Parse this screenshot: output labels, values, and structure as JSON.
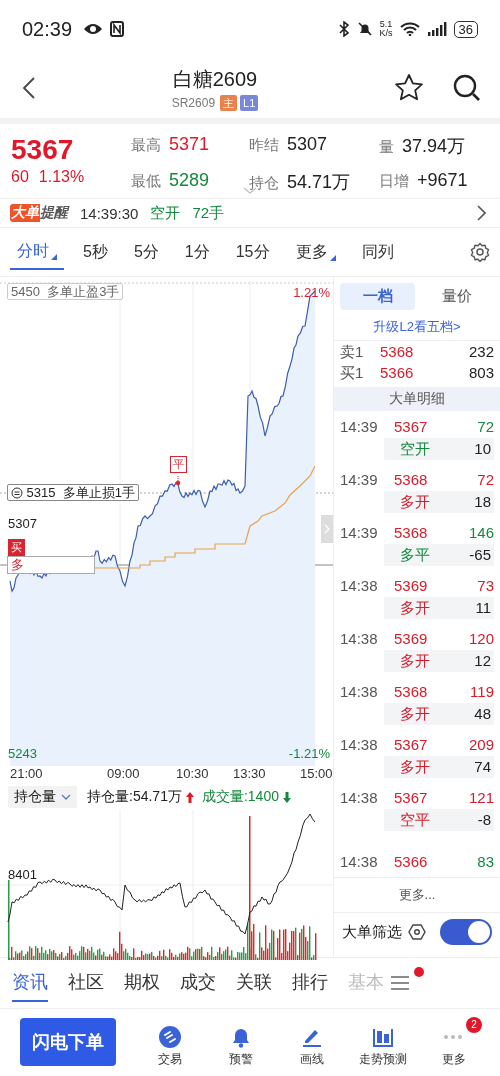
{
  "status_bar": {
    "time": "02:39",
    "net_speed_value": "5.1",
    "net_speed_unit": "K/s",
    "battery": "36"
  },
  "header": {
    "title": "白糖2609",
    "code": "SR2609",
    "badges": [
      {
        "label": "主",
        "color": "#e8814a"
      },
      {
        "label": "L1",
        "color": "#7a87d6"
      }
    ]
  },
  "quote": {
    "price": "5367",
    "change": "60",
    "change_pct": "1.13%",
    "stats": [
      {
        "label": "最高",
        "value": "5371",
        "color": "#e0192a"
      },
      {
        "label": "昨结",
        "value": "5307",
        "color": "#222222"
      },
      {
        "label": "量",
        "value": "37.94万",
        "color": "#222222"
      },
      {
        "label": "最低",
        "value": "5289",
        "color": "#14883c"
      },
      {
        "label": "持仓",
        "value": "54.71万",
        "color": "#222222"
      },
      {
        "label": "日增",
        "value": "+9671",
        "color": "#222222"
      }
    ]
  },
  "alert": {
    "badge_a": "大单",
    "badge_b": "提醒",
    "time": "14:39:30",
    "type": "空开",
    "lots": "72手"
  },
  "period_tabs": [
    {
      "label": "分时",
      "selected": true,
      "dropdown": true
    },
    {
      "label": "5秒",
      "selected": false,
      "dropdown": false
    },
    {
      "label": "5分",
      "selected": false,
      "dropdown": false
    },
    {
      "label": "1分",
      "selected": false,
      "dropdown": false
    },
    {
      "label": "15分",
      "selected": false,
      "dropdown": false
    },
    {
      "label": "更多",
      "selected": false,
      "dropdown": true
    },
    {
      "label": "同列",
      "selected": false,
      "dropdown": false
    }
  ],
  "price_chart": {
    "tp_price": "5450",
    "tp_text": "多单止盈3手",
    "high_pct": "1.21%",
    "sl_price": "5315",
    "sl_text": "多单止损1手",
    "prev_close": "5307",
    "buy_mark": "买",
    "position_tag": "多",
    "close_mark": "平",
    "low_price": "5243",
    "low_pct": "-1.21%",
    "x_labels": [
      "21:00",
      "09:00",
      "10:30",
      "13:30",
      "15:00"
    ]
  },
  "lower_chart": {
    "selector": "持仓量",
    "oi_label": "持仓量:54.71万",
    "oi_rising": true,
    "vol_label": "成交量:1400",
    "vol_rising": false,
    "y_label": "8401"
  },
  "side_panel": {
    "tabs": [
      {
        "label": "一档",
        "selected": true
      },
      {
        "label": "量价",
        "selected": false
      }
    ],
    "upgrade_link": "升级L2看五档>",
    "book": [
      {
        "label": "卖1",
        "price": "5368",
        "volume": "232"
      },
      {
        "label": "买1",
        "price": "5366",
        "volume": "803"
      }
    ],
    "trades_title": "大单明细",
    "trades": [
      {
        "time": "14:39",
        "price": "5367",
        "volume": "72",
        "color": "#14883c",
        "type": {
          "label": "空开",
          "color": "#14883c"
        },
        "change": "10"
      },
      {
        "time": "14:39",
        "price": "5368",
        "volume": "72",
        "color": "#d91b2a",
        "type": {
          "label": "多开",
          "color": "#d91b2a"
        },
        "change": "18"
      },
      {
        "time": "14:39",
        "price": "5368",
        "volume": "146",
        "color": "#14883c",
        "type": {
          "label": "多平",
          "color": "#14883c"
        },
        "change": "-65"
      },
      {
        "time": "14:38",
        "price": "5369",
        "volume": "73",
        "color": "#d91b2a",
        "type": {
          "label": "多开",
          "color": "#d91b2a"
        },
        "change": "11"
      },
      {
        "time": "14:38",
        "price": "5369",
        "volume": "120",
        "color": "#d91b2a",
        "type": {
          "label": "多开",
          "color": "#d91b2a"
        },
        "change": "12"
      },
      {
        "time": "14:38",
        "price": "5368",
        "volume": "119",
        "color": "#d91b2a",
        "type": {
          "label": "多开",
          "color": "#d91b2a"
        },
        "change": "48"
      },
      {
        "time": "14:38",
        "price": "5367",
        "volume": "209",
        "color": "#d91b2a",
        "type": {
          "label": "多开",
          "color": "#d91b2a"
        },
        "change": "74"
      },
      {
        "time": "14:38",
        "price": "5367",
        "volume": "121",
        "color": "#d91b2a",
        "type": {
          "label": "空平",
          "color": "#d91b2a"
        },
        "change": "-8"
      },
      {
        "time": "14:38",
        "price": "5366",
        "volume": "83",
        "color": "#14883c"
      }
    ],
    "more": "更多...",
    "filter": {
      "label": "大单筛选",
      "on": true
    }
  },
  "bottom_tabs": [
    {
      "label": "资讯",
      "selected": true,
      "faded": false
    },
    {
      "label": "社区",
      "selected": false,
      "faded": false
    },
    {
      "label": "期权",
      "selected": false,
      "faded": false
    },
    {
      "label": "成交",
      "selected": false,
      "faded": false
    },
    {
      "label": "关联",
      "selected": false,
      "faded": false
    },
    {
      "label": "排行",
      "selected": false,
      "faded": false
    },
    {
      "label": "基本",
      "selected": false,
      "faded": true
    }
  ],
  "action_bar": {
    "primary": "闪电下单",
    "items": [
      {
        "label": "交易",
        "kind": "trade"
      },
      {
        "label": "预警",
        "kind": "alarm"
      },
      {
        "label": "画线",
        "kind": "draw"
      },
      {
        "label": "走势预测",
        "kind": "forecast"
      },
      {
        "label": "更多",
        "kind": "more",
        "badge": "2"
      }
    ]
  }
}
